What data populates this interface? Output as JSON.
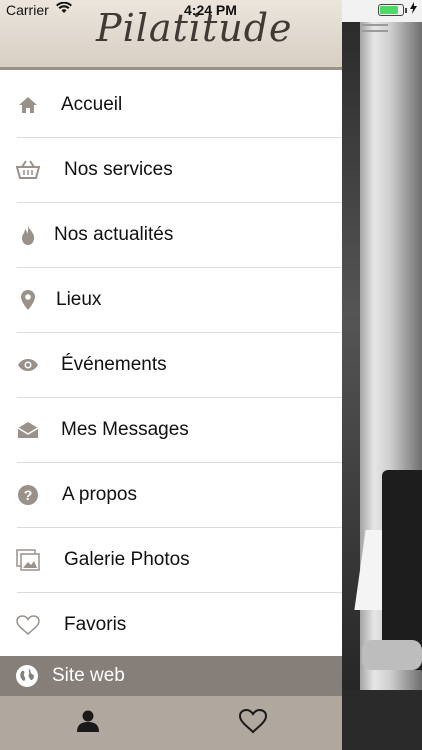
{
  "status_bar": {
    "carrier": "Carrier",
    "time": "4:24 PM",
    "battery_level": 0.8
  },
  "header": {
    "logo_text": "Pilatitude"
  },
  "menu": {
    "items": [
      {
        "label": "Accueil",
        "icon": "home-icon"
      },
      {
        "label": "Nos services",
        "icon": "basket-icon"
      },
      {
        "label": "Nos actualités",
        "icon": "flame-icon"
      },
      {
        "label": "Lieux",
        "icon": "location-pin-icon"
      },
      {
        "label": "Événements",
        "icon": "eye-icon"
      },
      {
        "label": "Mes Messages",
        "icon": "envelope-icon"
      },
      {
        "label": "A propos",
        "icon": "question-icon"
      },
      {
        "label": "Galerie Photos",
        "icon": "photos-icon"
      },
      {
        "label": "Favoris",
        "icon": "heart-outline-icon"
      }
    ]
  },
  "site_web": {
    "label": "Site web",
    "icon": "globe-icon"
  },
  "tab_bar": {
    "tabs": [
      {
        "name": "profile",
        "icon": "user-icon"
      },
      {
        "name": "favorites",
        "icon": "heart-icon"
      }
    ]
  },
  "colors": {
    "accent": "#867e78",
    "tab_bar": "#b0a79f",
    "icon": "#9a928a"
  }
}
